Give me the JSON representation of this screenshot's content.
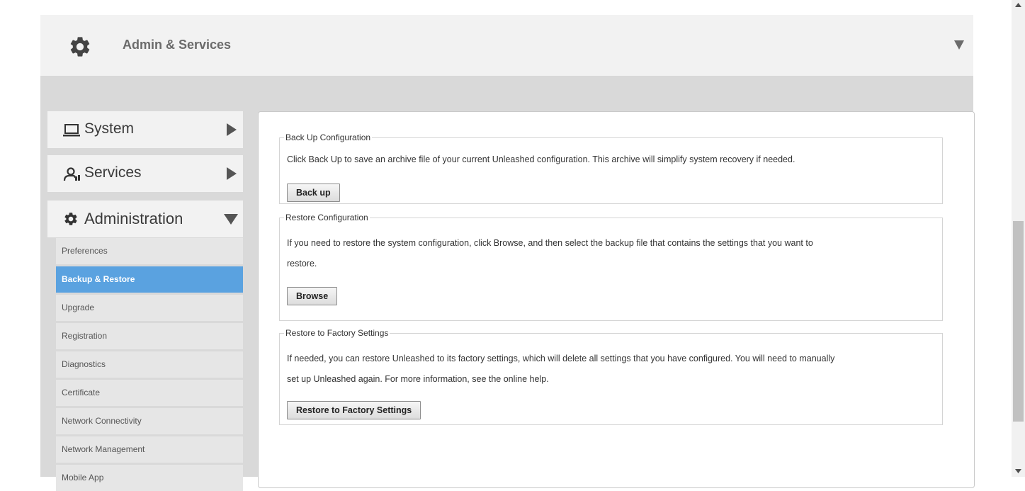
{
  "header": {
    "title": "Admin & Services",
    "icon": "gear-icon"
  },
  "sidebar": {
    "categories": [
      {
        "label": "System",
        "icon": "monitor-icon",
        "expanded": false
      },
      {
        "label": "Services",
        "icon": "services-icon",
        "expanded": false
      },
      {
        "label": "Administration",
        "icon": "gear-icon",
        "expanded": true
      }
    ],
    "items": [
      {
        "label": "Preferences"
      },
      {
        "label": "Backup & Restore",
        "active": true
      },
      {
        "label": "Upgrade"
      },
      {
        "label": "Registration"
      },
      {
        "label": "Diagnostics"
      },
      {
        "label": "Certificate"
      },
      {
        "label": "Network Connectivity"
      },
      {
        "label": "Network Management"
      },
      {
        "label": "Mobile App"
      }
    ]
  },
  "sections": {
    "backup": {
      "legend": "Back Up Configuration",
      "line1": "Click Back Up to save an archive file of your current Unleashed configuration. This archive will simplify system recovery if needed.",
      "button": "Back up"
    },
    "restore": {
      "legend": "Restore Configuration",
      "line1": "If you need to restore the system configuration, click Browse, and then select the backup file that contains the settings that you want to",
      "line2": "restore.",
      "button": "Browse"
    },
    "factory": {
      "legend": "Restore to Factory Settings",
      "line1": "If needed, you can restore Unleashed to its factory settings, which will delete all settings that you have configured. You will need to manually",
      "line2": "set up Unleashed again. For more information, see the online help.",
      "button": "Restore to Factory Settings"
    }
  },
  "colors": {
    "active_item": "#5aa2e0",
    "outer_background": "#d9d9d9",
    "header_background": "#f2f2f2"
  }
}
